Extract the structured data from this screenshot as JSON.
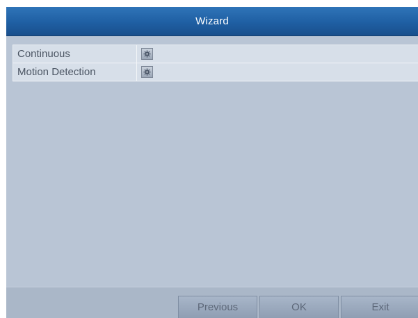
{
  "window": {
    "title": "Wizard"
  },
  "schedule": {
    "rows": [
      {
        "label": "Continuous",
        "action_icon": "gear-icon"
      },
      {
        "label": "Motion Detection",
        "action_icon": "gear-icon"
      }
    ]
  },
  "footer": {
    "previous_label": "Previous",
    "ok_label": "OK",
    "exit_label": "Exit"
  },
  "colors": {
    "titlebar": "#1f5fa3",
    "panel": "#b9c5d5",
    "row": "#d7dfe9",
    "button": "#9aa8bb"
  }
}
